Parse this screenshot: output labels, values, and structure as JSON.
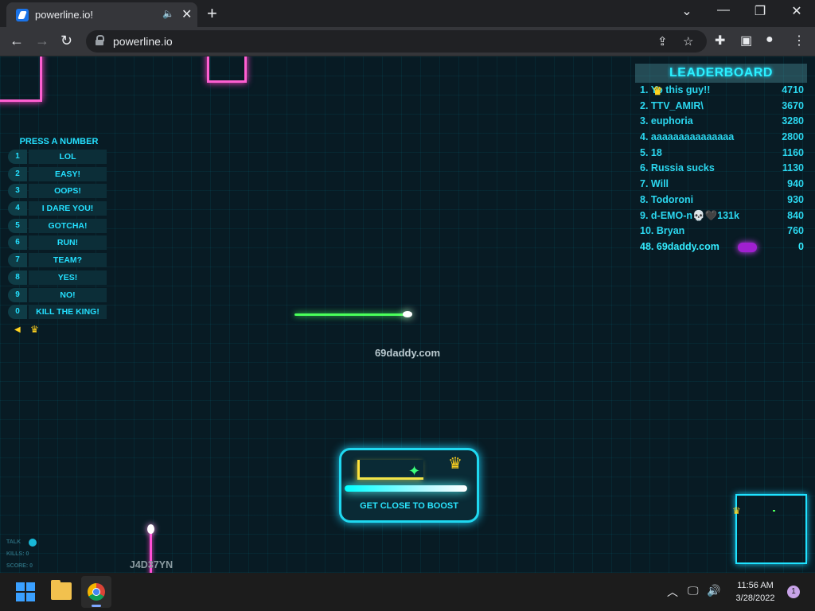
{
  "browser": {
    "tab_title": "powerline.io!",
    "tab_audio_icon": "speaker-icon",
    "tab_close_icon": "close-icon",
    "new_tab_icon": "plus-icon",
    "url": "powerline.io",
    "window_controls": [
      "chevron-down-icon",
      "minimize-icon",
      "restore-icon",
      "close-icon"
    ]
  },
  "emote_panel": {
    "title": "PRESS A NUMBER",
    "items": [
      {
        "key": "1",
        "label": "LOL"
      },
      {
        "key": "2",
        "label": "EASY!"
      },
      {
        "key": "3",
        "label": "OOPS!"
      },
      {
        "key": "4",
        "label": "I DARE YOU!"
      },
      {
        "key": "5",
        "label": "GOTCHA!"
      },
      {
        "key": "6",
        "label": "RUN!"
      },
      {
        "key": "7",
        "label": "TEAM?"
      },
      {
        "key": "8",
        "label": "YES!"
      },
      {
        "key": "9",
        "label": "NO!"
      },
      {
        "key": "0",
        "label": "KILL THE KING!"
      }
    ]
  },
  "leaderboard": {
    "title": "LEADERBOARD",
    "rows": [
      {
        "rank": "1.",
        "name": "Yo this guy!!",
        "score": "4710"
      },
      {
        "rank": "2.",
        "name": "TTV_AMIR\\",
        "score": "3670"
      },
      {
        "rank": "3.",
        "name": "euphoria",
        "score": "3280"
      },
      {
        "rank": "4.",
        "name": "aaaaaaaaaaaaaaa",
        "score": "2800"
      },
      {
        "rank": "5.",
        "name": "18",
        "score": "1160"
      },
      {
        "rank": "6.",
        "name": "Russia sucks",
        "score": "1130"
      },
      {
        "rank": "7.",
        "name": "Will",
        "score": "940"
      },
      {
        "rank": "8.",
        "name": "Todoroni",
        "score": "930"
      },
      {
        "rank": "9.",
        "name": "d-EMO-n💀🖤131k",
        "score": "840"
      },
      {
        "rank": "10.",
        "name": "Bryan",
        "score": "760"
      }
    ],
    "self": {
      "rank": "48.",
      "name": "69daddy.com",
      "score": "0"
    }
  },
  "game": {
    "player_name": "69daddy.com",
    "other_player_name": "J4D37YN",
    "boost_hint": "GET CLOSE TO BOOST",
    "stats": [
      "TALK",
      "KILLS: 0",
      "SCORE: 0"
    ],
    "colors": {
      "player": "#4aff5a",
      "other": "#ff4fd6",
      "ui": "#24e0ff",
      "king": "#ffd21f"
    }
  },
  "taskbar": {
    "time": "11:56 AM",
    "date": "3/28/2022",
    "notifications": "1"
  }
}
